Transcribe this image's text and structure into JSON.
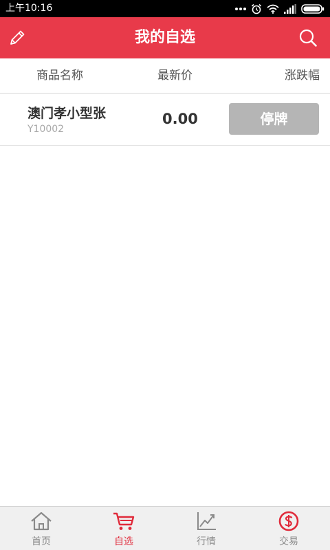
{
  "status_bar": {
    "time": "上午10:16"
  },
  "header": {
    "title": "我的自选",
    "edit_icon": "pencil-icon",
    "search_icon": "search-icon"
  },
  "columns": {
    "name": "商品名称",
    "price": "最新价",
    "change": "涨跌幅"
  },
  "list": {
    "rows": [
      {
        "name": "澳门孝小型张",
        "code": "Y10002",
        "price": "0.00",
        "status": "停牌"
      }
    ]
  },
  "tabbar": {
    "tabs": [
      {
        "label": "首页",
        "icon": "home-icon",
        "active": false
      },
      {
        "label": "自选",
        "icon": "cart-icon",
        "active": true
      },
      {
        "label": "行情",
        "icon": "trend-chart-icon",
        "active": false
      },
      {
        "label": "交易",
        "icon": "dollar-circle-icon",
        "active": false
      }
    ]
  },
  "colors": {
    "brand_red": "#e83a4a",
    "active_tab": "#e02b3b",
    "suspended_badge": "#b5b5b5"
  }
}
